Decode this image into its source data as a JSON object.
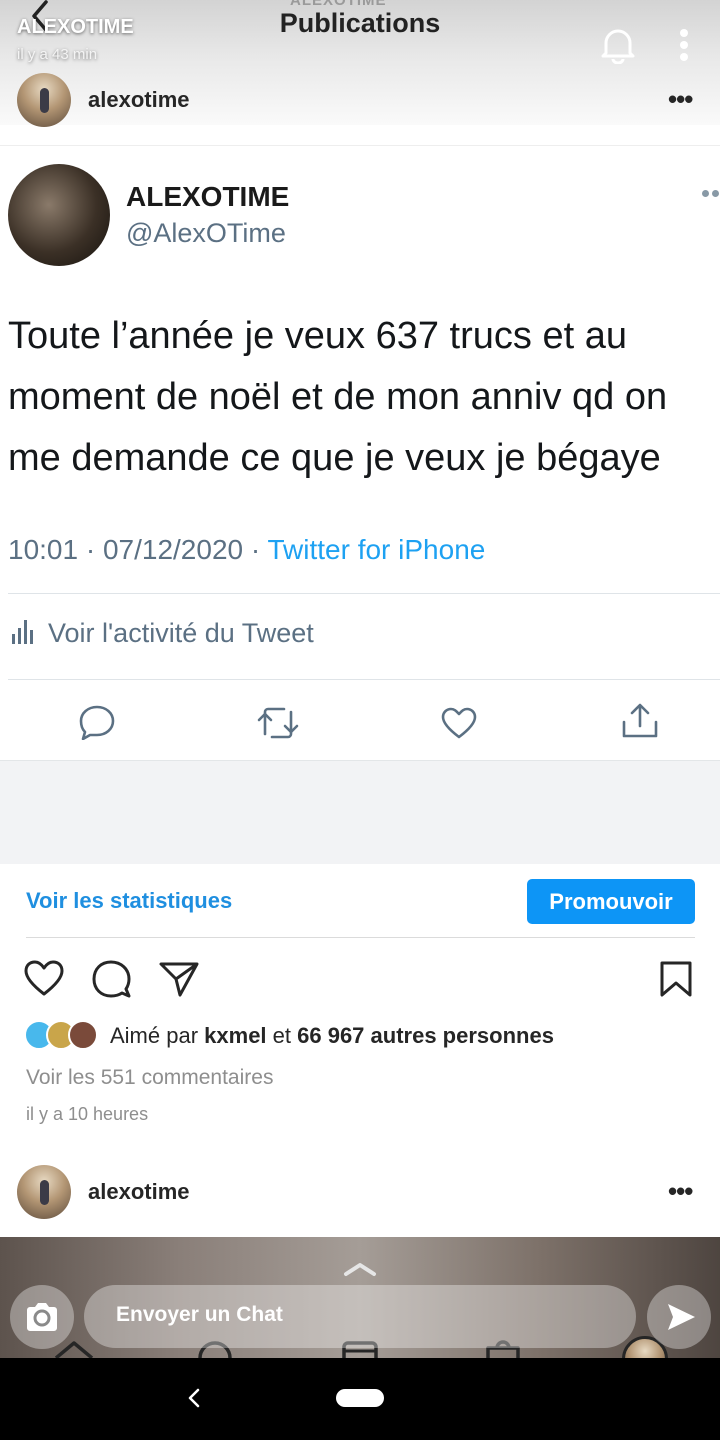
{
  "story": {
    "user": "ALEXOTIME",
    "time": "il y a 43 min"
  },
  "header": {
    "subtitle": "ALEXOTIME",
    "title": "Publications"
  },
  "post_top": {
    "username": "alexotime",
    "more": "•••"
  },
  "tweet": {
    "name": "ALEXOTIME",
    "handle": "@AlexOTime",
    "text": "Toute l’année je veux 637 trucs et au moment de noël et de mon anniv qd on me demande ce que je veux je bégaye",
    "time": "10:01 · 07/12/2020 · ",
    "source": "Twitter for iPhone",
    "activity": "Voir l'activité du Tweet"
  },
  "actions": {
    "stats": "Voir les statistiques",
    "promote": "Promouvoir"
  },
  "likes": {
    "prefix": "Aimé par ",
    "user": "kxmel",
    "middle": " et ",
    "count": "66 967 autres personnes"
  },
  "comments": "Voir les 551 commentaires",
  "posted_ago": "il y a 10 heures",
  "post_next": {
    "username": "alexotime",
    "more": "•••"
  },
  "chat": {
    "placeholder": "Envoyer un Chat"
  },
  "colors": {
    "twitter_blue": "#1da1f2",
    "ig_blue": "#0d95f6",
    "link_blue": "#1f8fe0"
  }
}
